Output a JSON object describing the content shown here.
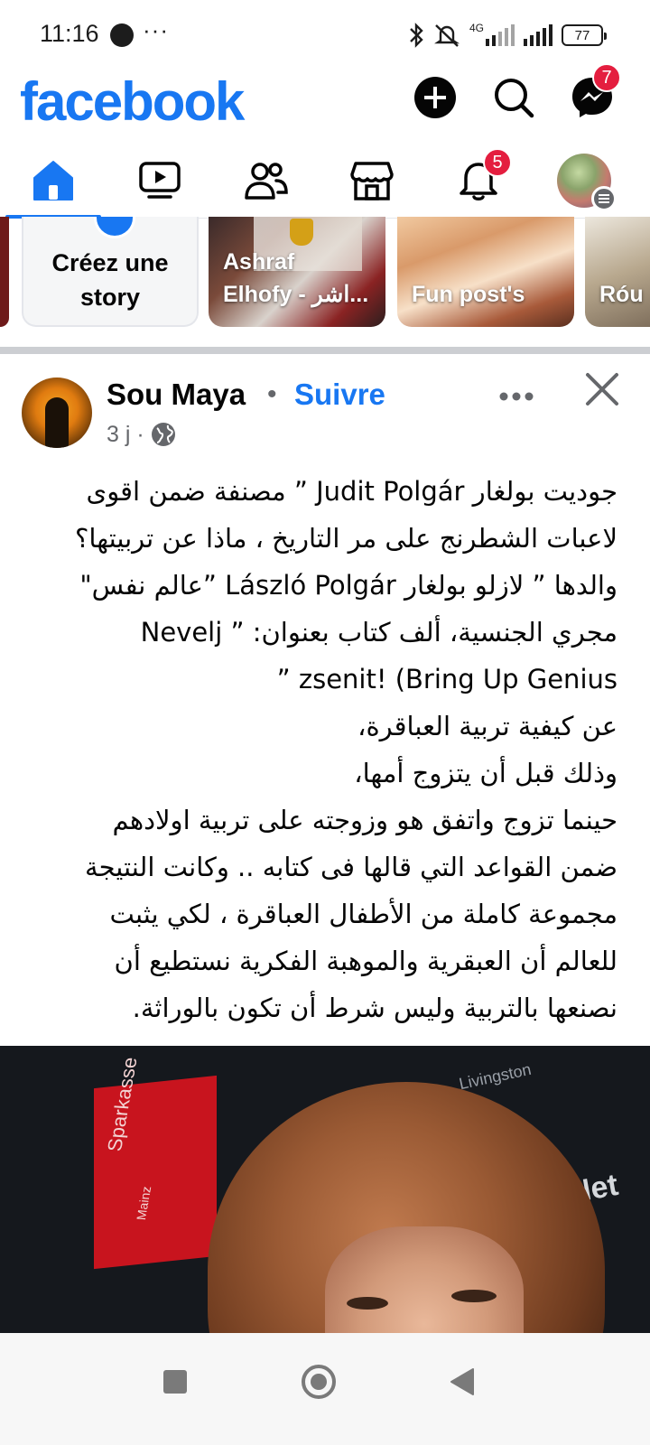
{
  "status_bar": {
    "time": "11:16",
    "more": "···",
    "network": "4G",
    "battery": "77"
  },
  "header": {
    "logo": "facebook",
    "create_icon": "plus-circle-icon",
    "search_icon": "search-icon",
    "messenger_icon": "messenger-icon",
    "messenger_badge": "7"
  },
  "nav": {
    "tabs": [
      {
        "name": "home",
        "icon": "home-icon",
        "active": true
      },
      {
        "name": "video",
        "icon": "video-icon"
      },
      {
        "name": "friends",
        "icon": "friends-icon"
      },
      {
        "name": "marketplace",
        "icon": "marketplace-icon"
      },
      {
        "name": "notifications",
        "icon": "bell-icon",
        "badge": "5"
      },
      {
        "name": "menu",
        "icon": "profile-menu-icon"
      }
    ]
  },
  "stories": {
    "create_label": "Créez une story",
    "items": [
      {
        "label": "Ashraf\nElhofy - اشر..."
      },
      {
        "label": "Fun post's"
      },
      {
        "label": "Róu"
      }
    ]
  },
  "post": {
    "author": "Sou Maya",
    "separator": "•",
    "follow_label": "Suivre",
    "time": "3 j ·",
    "privacy_icon": "globe-icon",
    "lines": [
      "جوديت بولغار Judit Polgár ” مصنفة ضمن اقوى",
      "لاعبات الشطرنج على مر التاريخ ، ماذا عن تربيتها؟",
      "والدها ” لازلو بولغار László Polgár ”عالم نفس\"",
      "مجري الجنسية، ألف كتاب بعنوان: ” Nevelj",
      "zsenit! (Bring Up Genius ”",
      "عن كيفية تربية العباقرة،",
      "وذلك قبل أن يتزوج أمها،",
      "حينما تزوج واتفق هو وزوجته على تربية اولادهم",
      "ضمن القواعد التي قالها فى كتابه .. وكانت النتيجة",
      "مجموعة كاملة من الأطفال العباقرة ، لكي يثبت",
      "للعالم أن العبقرية والموهبة الفكرية نستطيع أن",
      "نصنعها بالتربية وليس شرط أن تكون بالوراثة."
    ],
    "image": {
      "banner_text": "Sparkasse",
      "banner_sub": "Mainz",
      "sponsor_1": "FiNet",
      "sponsor_2": "Livingston"
    }
  },
  "system_nav": {
    "recent_icon": "square-icon",
    "home_icon": "circle-home-icon",
    "back_icon": "back-triangle-icon"
  },
  "colors": {
    "brand": "#1877f2",
    "badge": "#e41e3f",
    "text": "#050505",
    "muted": "#65676b"
  }
}
